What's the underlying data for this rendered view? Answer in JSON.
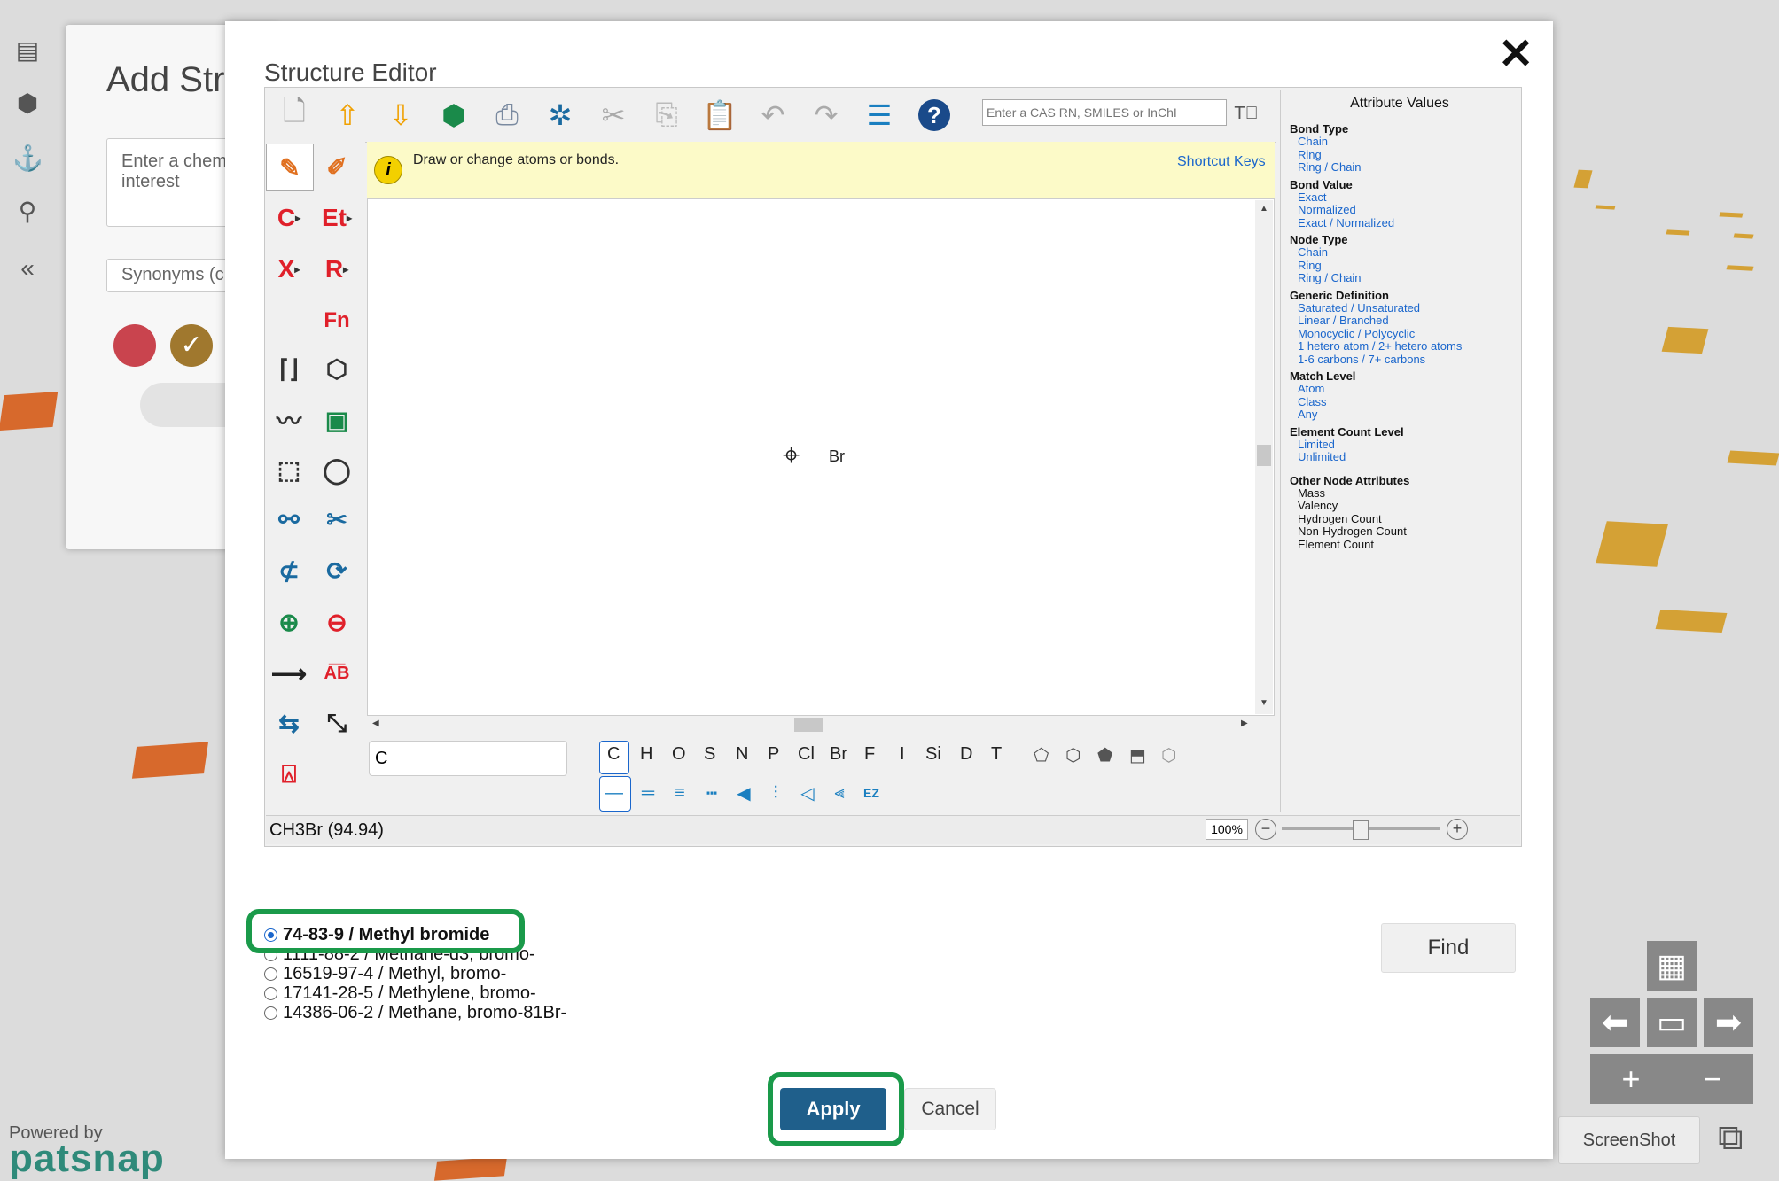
{
  "background": {
    "panel_title": "Add Str",
    "search_placeholder": "Enter a chem\ninterest",
    "synonyms_label": "Synonyms (c",
    "powered_by": "Powered by",
    "brand": "patsnap",
    "screenshot_label": "ScreenShot"
  },
  "modal": {
    "title": "Structure Editor",
    "close_glyph": "✕",
    "toolbar": {
      "search_placeholder": "Enter a CAS RN, SMILES or InChI",
      "help_glyph": "?"
    },
    "hint": {
      "text": "Draw or change atoms or bonds.",
      "shortcut_link": "Shortcut Keys",
      "info_glyph": "i"
    },
    "left_tools": [
      {
        "label": "C",
        "sub": "▸",
        "color": "#e0202a"
      },
      {
        "label": "Et",
        "sub": "▸",
        "color": "#e0202a"
      },
      {
        "label": "X",
        "sub": "▸",
        "color": "#e0202a"
      },
      {
        "label": "R",
        "sub": "▸",
        "color": "#e0202a"
      },
      {
        "label": "Fn",
        "sub": "",
        "color": "#e0202a"
      }
    ],
    "canvas": {
      "atom_label": "Br",
      "crosshair_glyph": "⌖"
    },
    "atom_input_value": "C",
    "elements": [
      "C",
      "H",
      "O",
      "S",
      "N",
      "P",
      "Cl",
      "Br",
      "F",
      "I",
      "Si",
      "D",
      "T"
    ],
    "formula": "CH3Br (94.94)",
    "zoom_value": "100%",
    "zoom_minus": "−",
    "zoom_plus": "+",
    "attributes": {
      "title": "Attribute Values",
      "groups": [
        {
          "head": "Bond Type",
          "items": [
            "Chain",
            "Ring",
            "Ring / Chain"
          ]
        },
        {
          "head": "Bond Value",
          "items": [
            "Exact",
            "Normalized",
            "Exact / Normalized"
          ]
        },
        {
          "head": "Node Type",
          "items": [
            "Chain",
            "Ring",
            "Ring / Chain"
          ]
        },
        {
          "head": "Generic Definition",
          "items": [
            "Saturated / Unsaturated",
            "Linear / Branched",
            "Monocyclic / Polycyclic",
            "1 hetero atom / 2+ hetero atoms",
            "1-6 carbons / 7+ carbons"
          ]
        },
        {
          "head": "Match Level",
          "items": [
            "Atom",
            "Class",
            "Any"
          ]
        },
        {
          "head": "Element Count Level",
          "items": [
            "Limited",
            "Unlimited"
          ]
        }
      ],
      "other_head": "Other Node Attributes",
      "other_items": [
        "Mass",
        "Valency",
        "Hydrogen Count",
        "Non-Hydrogen Count",
        "Element Count"
      ]
    },
    "results": [
      {
        "label": "74-83-9 / Methyl bromide",
        "selected": true
      },
      {
        "label": "1111-88-2 / Methane-d3, bromo-",
        "selected": false
      },
      {
        "label": "16519-97-4 / Methyl, bromo-",
        "selected": false
      },
      {
        "label": "17141-28-5 / Methylene, bromo-",
        "selected": false
      },
      {
        "label": "14386-06-2 / Methane, bromo-81Br-",
        "selected": false
      }
    ],
    "find_label": "Find",
    "apply_label": "Apply",
    "cancel_label": "Cancel"
  },
  "colors": {
    "apply_bg": "#1f5f8b",
    "highlight": "#1a9a4a",
    "link": "#1a66cc",
    "hint_bg": "#fcfac8"
  }
}
